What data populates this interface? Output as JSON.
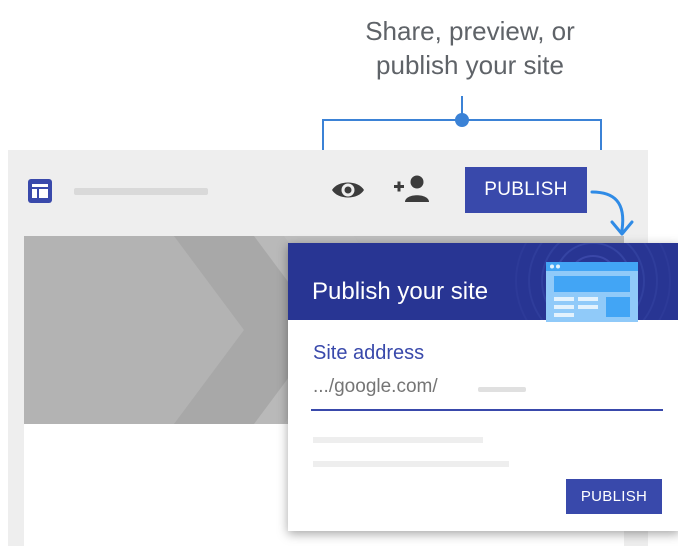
{
  "callout": {
    "line1": "Share, preview, or",
    "line2": "publish your site"
  },
  "toolbar": {
    "publish_label": "PUBLISH",
    "icons": [
      "site-layout-icon",
      "eye-icon",
      "person-add-icon"
    ]
  },
  "dialog": {
    "title": "Publish your site",
    "field_label": "Site address",
    "field_value": ".../google.com/",
    "publish_label": "PUBLISH"
  },
  "colors": {
    "accent": "#3949ab",
    "header": "#283593",
    "callout_line": "#3b82d6",
    "arrow": "#2f8be6"
  }
}
